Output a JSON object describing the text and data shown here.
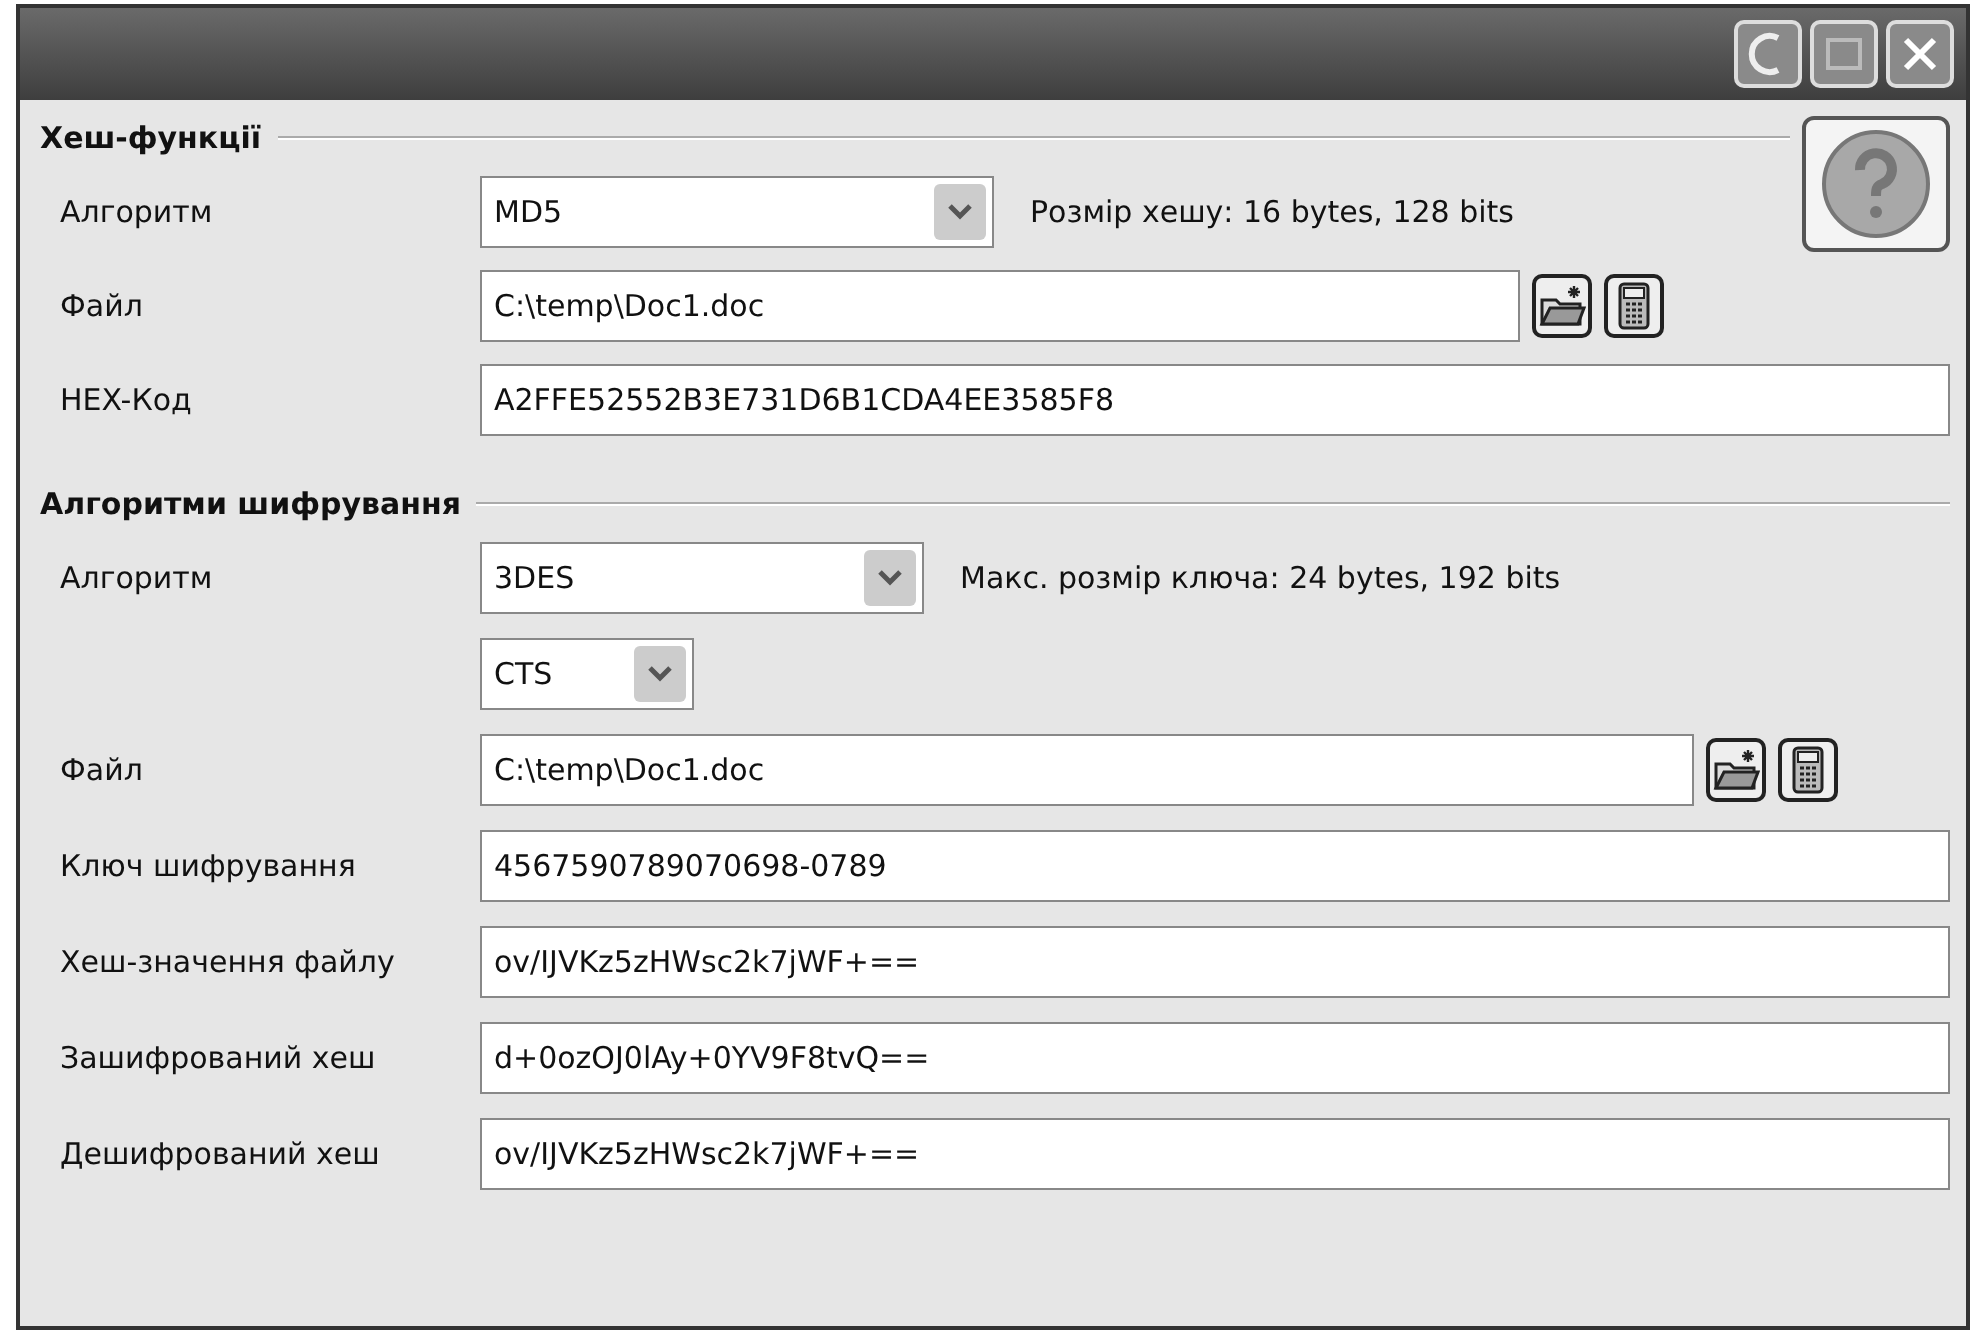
{
  "hash_section": {
    "title": "Хеш-функції",
    "algorithm": {
      "label": "Алгоритм",
      "value": "MD5"
    },
    "size_info": "Розмір хешу: 16 bytes, 128 bits",
    "file": {
      "label": "Файл",
      "value": "C:\\temp\\Doc1.doc"
    },
    "hex": {
      "label": "HEX-Код",
      "value": "A2FFE52552B3E731D6B1CDA4EE3585F8"
    }
  },
  "crypto_section": {
    "title": "Алгоритми шифрування",
    "algorithm": {
      "label": "Алгоритм",
      "value": "3DES"
    },
    "size_info": "Макс. розмір ключа: 24 bytes, 192 bits",
    "mode": {
      "value": "CTS"
    },
    "file": {
      "label": "Файл",
      "value": "C:\\temp\\Doc1.doc"
    },
    "fields": [
      {
        "label": "Ключ шифрування",
        "value": "4567590789070698-0789"
      },
      {
        "label": "Хеш-значення файлу",
        "value": "ov/IJVKz5zHWsc2k7jWF+=="
      },
      {
        "label": "Зашифрований хеш",
        "value": "d+0ozOJ0lAy+0YV9F8tvQ=="
      },
      {
        "label": "Дешифрований хеш",
        "value": "ov/IJVKz5zHWsc2k7jWF+=="
      }
    ]
  }
}
